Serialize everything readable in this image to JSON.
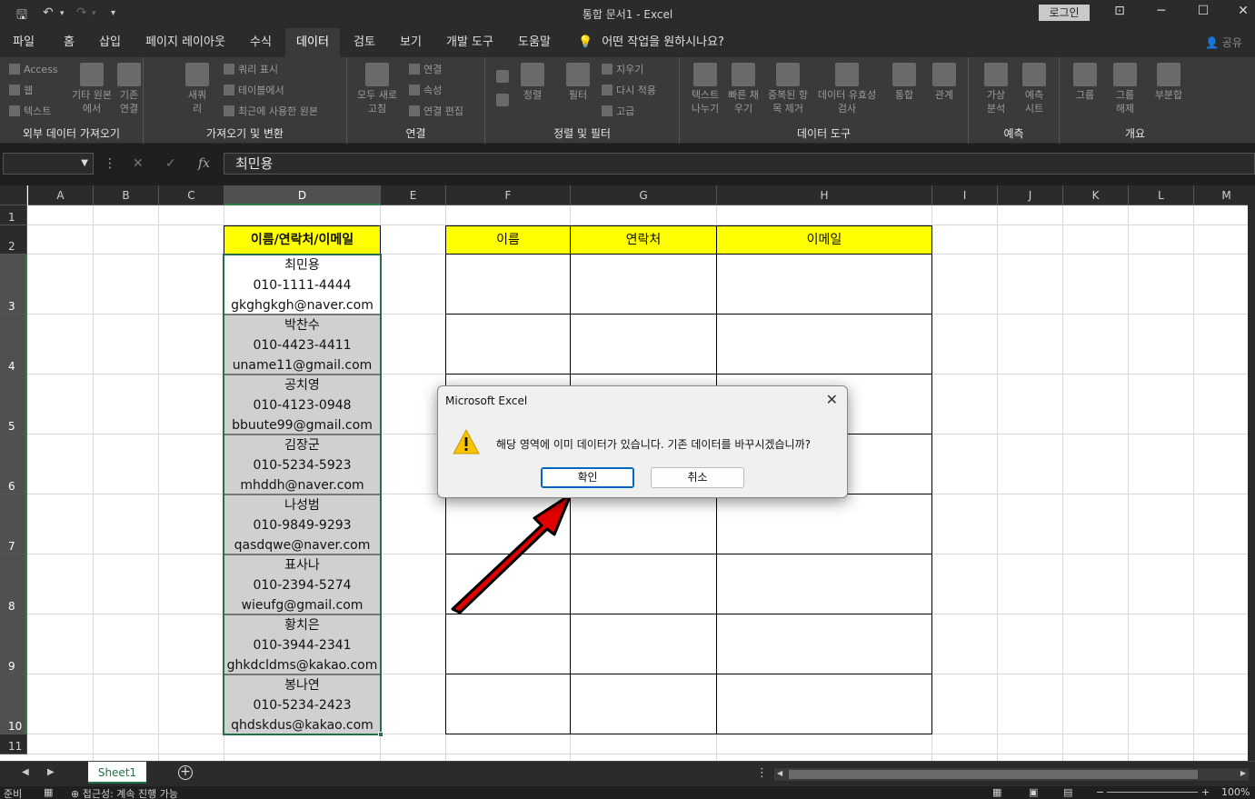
{
  "window": {
    "title": "통합 문서1  -  Excel",
    "login": "로그인",
    "qat_more": "▾"
  },
  "menu": {
    "tabs": [
      "파일",
      "홈",
      "삽입",
      "페이지 레이아웃",
      "수식",
      "데이터",
      "검토",
      "보기",
      "개발 도구",
      "도움말"
    ],
    "active": "데이터",
    "tell_me": "어떤 작업을 원하시나요?",
    "share": "공유"
  },
  "ribbon": {
    "groups": [
      {
        "label": "외부 데이터 가져오기",
        "small": [
          "Access",
          "웹",
          "텍스트"
        ],
        "big": [
          "기타 원본에서",
          "기존 연결"
        ]
      },
      {
        "label": "가져오기 및 변환",
        "big": [
          "새쿼리"
        ],
        "small": [
          "쿼리 표시",
          "테이블에서",
          "최근에 사용한 원본"
        ]
      },
      {
        "label": "연결",
        "big": [
          "모두 새로 고침"
        ],
        "small": [
          "연결",
          "속성",
          "연결 편집"
        ]
      },
      {
        "label": "정렬 및 필터",
        "big": [
          "정렬",
          "필터"
        ],
        "small": [
          "지우기",
          "다시 적용",
          "고급"
        ]
      },
      {
        "label": "데이터 도구",
        "big": [
          "텍스트 나누기",
          "빠른 채우기",
          "중복된 항목 제거",
          "데이터 유효성 검사",
          "통합",
          "관계"
        ]
      },
      {
        "label": "예측",
        "big": [
          "가상 분석",
          "예측 시트"
        ]
      },
      {
        "label": "개요",
        "big": [
          "그룹",
          "그룹 해제",
          "부분합"
        ]
      }
    ]
  },
  "formula_bar": {
    "name_box": "",
    "fx": "fx",
    "content": "최민용"
  },
  "grid": {
    "columns": [
      "A",
      "B",
      "C",
      "D",
      "E",
      "F",
      "G",
      "H",
      "I",
      "J",
      "K",
      "L",
      "M"
    ],
    "rows": [
      "1",
      "2",
      "3",
      "4",
      "5",
      "6",
      "7",
      "8",
      "9",
      "10",
      "11"
    ],
    "header_d": "이름/연락처/이메일",
    "headers_fgh": [
      "이름",
      "연락처",
      "이메일"
    ],
    "records": [
      {
        "name": "최민용",
        "phone": "010-1111-4444",
        "email": "gkghgkgh@naver.com"
      },
      {
        "name": "박찬수",
        "phone": "010-4423-4411",
        "email": "uname11@gmail.com"
      },
      {
        "name": "공치영",
        "phone": "010-4123-0948",
        "email": "bbuute99@gmail.com"
      },
      {
        "name": "김장군",
        "phone": "010-5234-5923",
        "email": "mhddh@naver.com"
      },
      {
        "name": "나성범",
        "phone": "010-9849-9293",
        "email": "qasdqwe@naver.com"
      },
      {
        "name": "표사나",
        "phone": "010-2394-5274",
        "email": "wieufg@gmail.com"
      },
      {
        "name": "황치은",
        "phone": "010-3944-2341",
        "email": "ghkdcldms@kakao.com"
      },
      {
        "name": "봉나연",
        "phone": "010-5234-2423",
        "email": "qhdskdus@kakao.com"
      }
    ]
  },
  "sheets": {
    "active": "Sheet1",
    "add": "+"
  },
  "status": {
    "ready": "준비",
    "accessibility": "접근성: 계속 진행 가능",
    "zoom": "100%"
  },
  "dialog": {
    "title": "Microsoft Excel",
    "message": "해당 영역에 이미 데이터가 있습니다. 기존 데이터를 바꾸시겠습니까?",
    "ok": "확인",
    "cancel": "취소",
    "close": "✕"
  },
  "colors": {
    "header_fill": "#ffff00",
    "selected_fill": "#d0d0d0",
    "excel_green": "#217346",
    "arrow_red": "#e00000"
  }
}
